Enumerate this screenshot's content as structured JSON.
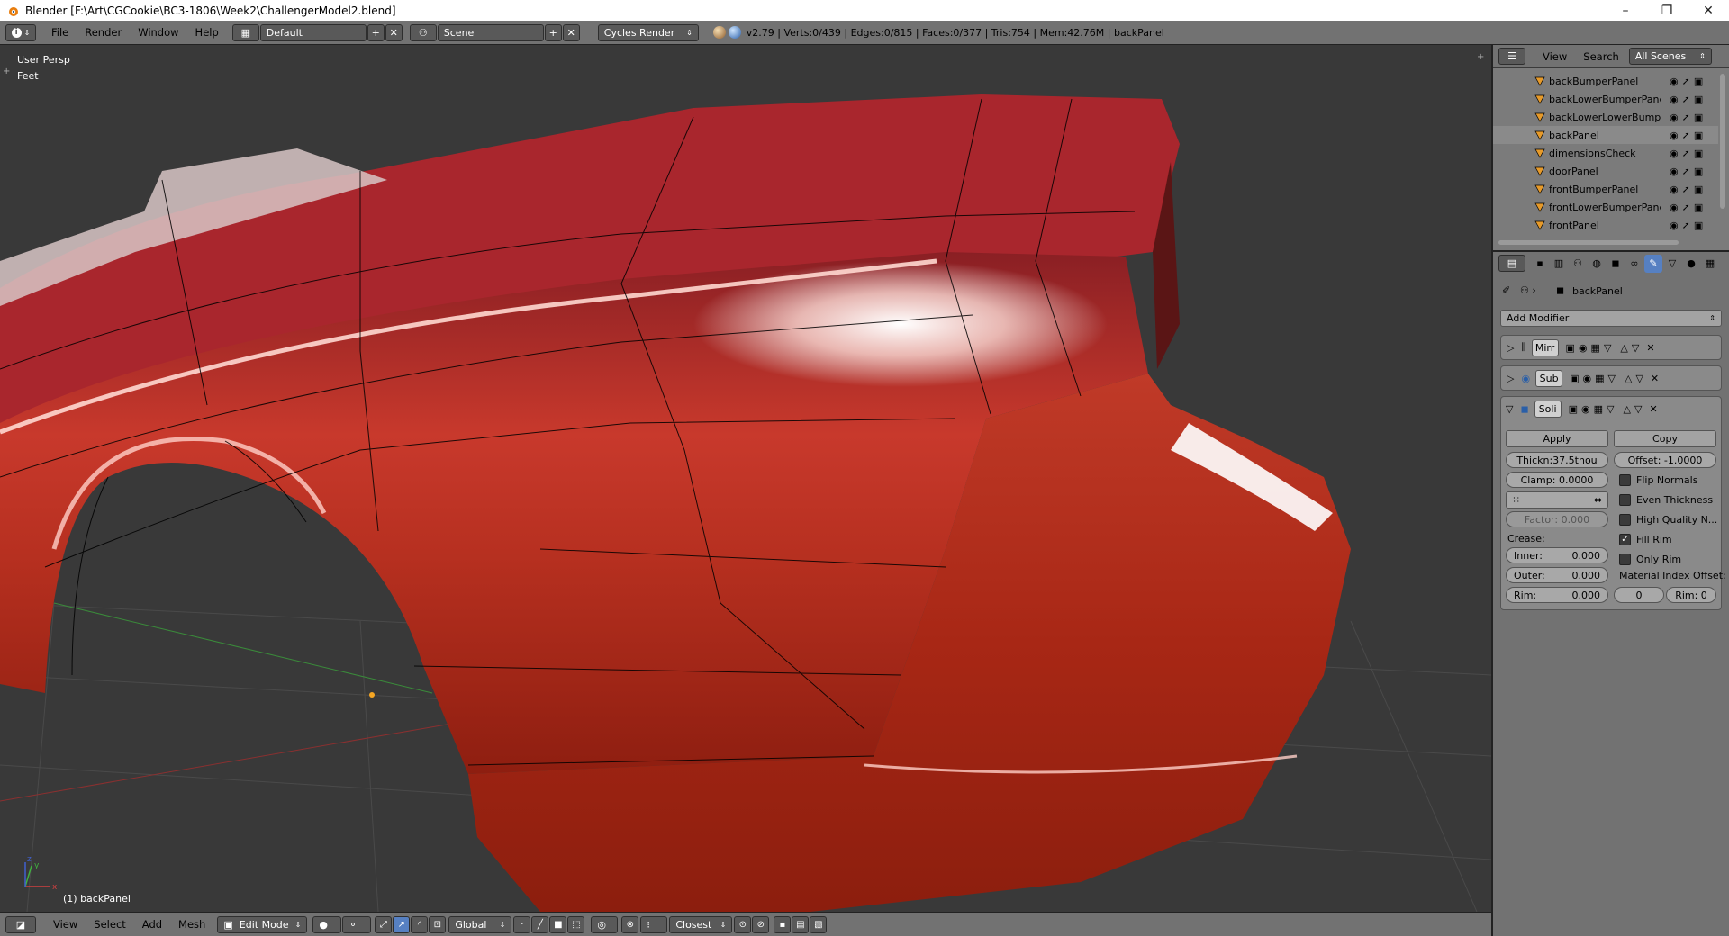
{
  "window": {
    "title": "Blender [F:\\Art\\CGCookie\\BC3-1806\\Week2\\ChallengerModel2.blend]",
    "minimize": "–",
    "maximize": "❐",
    "close": "✕"
  },
  "infobar": {
    "menus": [
      "File",
      "Render",
      "Window",
      "Help"
    ],
    "layout": "Default",
    "scene": "Scene",
    "engine": "Cycles Render",
    "stats": "v2.79 | Verts:0/439 | Edges:0/815 | Faces:0/377 | Tris:754 | Mem:42.76M | backPanel"
  },
  "viewport": {
    "view_name": "User Persp",
    "units": "Feet",
    "object_label": "(1) backPanel",
    "colors": {
      "background": "#393939",
      "mesh": "#b0291a",
      "highlight": "#ffffff",
      "grid": "#4a4a4a"
    }
  },
  "bottombar": {
    "menus": [
      "View",
      "Select",
      "Add",
      "Mesh"
    ],
    "mode": "Edit Mode",
    "orientation": "Global",
    "snap": "Closest"
  },
  "outliner": {
    "header": {
      "view": "View",
      "search": "Search",
      "scenes": "All Scenes"
    },
    "items": [
      "backBumperPanel",
      "backLowerBumperPanel",
      "backLowerLowerBumper",
      "backPanel",
      "dimensionsCheck",
      "doorPanel",
      "frontBumperPanel",
      "frontLowerBumperPanel.",
      "frontPanel"
    ],
    "selected_index": 3
  },
  "properties": {
    "object_name": "backPanel",
    "add_modifier": "Add Modifier",
    "modifiers": [
      {
        "name": "Mirr",
        "expanded": false
      },
      {
        "name": "Sub",
        "expanded": false
      },
      {
        "name": "Soli",
        "expanded": true
      }
    ],
    "solidify": {
      "apply": "Apply",
      "copy": "Copy",
      "thickness": "Thickn:37.5thou",
      "offset": "Offset:   -1.0000",
      "clamp": "Clamp:  0.0000",
      "vertex_group": "",
      "factor": "Factor:   0.000",
      "crease_label": "Crease:",
      "inner": "Inner:",
      "inner_val": "0.000",
      "outer": "Outer:",
      "outer_val": "0.000",
      "rim": "Rim:",
      "rim_val": "0.000",
      "flip_normals": "Flip Normals",
      "even_thickness": "Even Thickness",
      "high_quality": "High Quality N...",
      "fill_rim": "Fill Rim",
      "only_rim": "Only Rim",
      "material_offset_label": "Material Index Offset:",
      "mat_offset": "0",
      "mat_rim": "Rim:  0",
      "fill_rim_checked": true
    }
  }
}
